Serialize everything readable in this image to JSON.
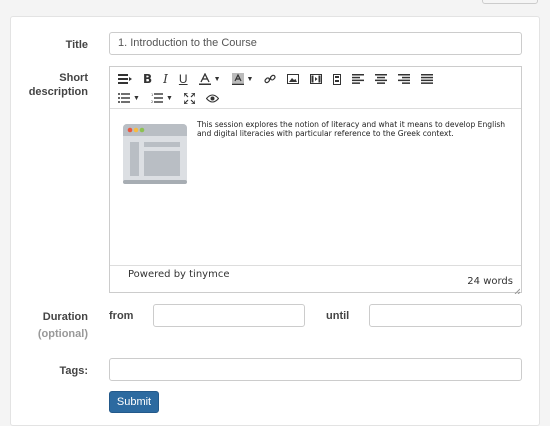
{
  "form": {
    "title_label": "Title",
    "title_value": "1. Introduction to the Course",
    "description_label": "Short description",
    "duration_label": "Duration",
    "duration_optional": "(optional)",
    "from_label": "from",
    "until_label": "until",
    "tags_label": "Tags:",
    "submit_label": "Submit"
  },
  "editor": {
    "toolbar_icons": [
      "align-icon",
      "bold-icon",
      "italic-icon",
      "underline-icon",
      "text-color-icon",
      "background-color-icon",
      "link-icon",
      "image-icon",
      "media-icon",
      "template-icon",
      "align-left-icon",
      "align-center-icon",
      "align-right-icon",
      "align-justify-icon",
      "bullet-list-icon",
      "numbered-list-icon",
      "fullscreen-icon",
      "preview-icon"
    ],
    "content_text": "This session explores the notion of literacy and what it means to develop English and digital literacies with particular reference to the Greek context.",
    "powered_by": "Powered by tinymce",
    "word_count": "24 words"
  },
  "colors": {
    "submit_bg": "#2c6aa0",
    "thumb_red": "#e9573f",
    "thumb_yellow": "#f6bb42",
    "thumb_green": "#8cc152"
  }
}
